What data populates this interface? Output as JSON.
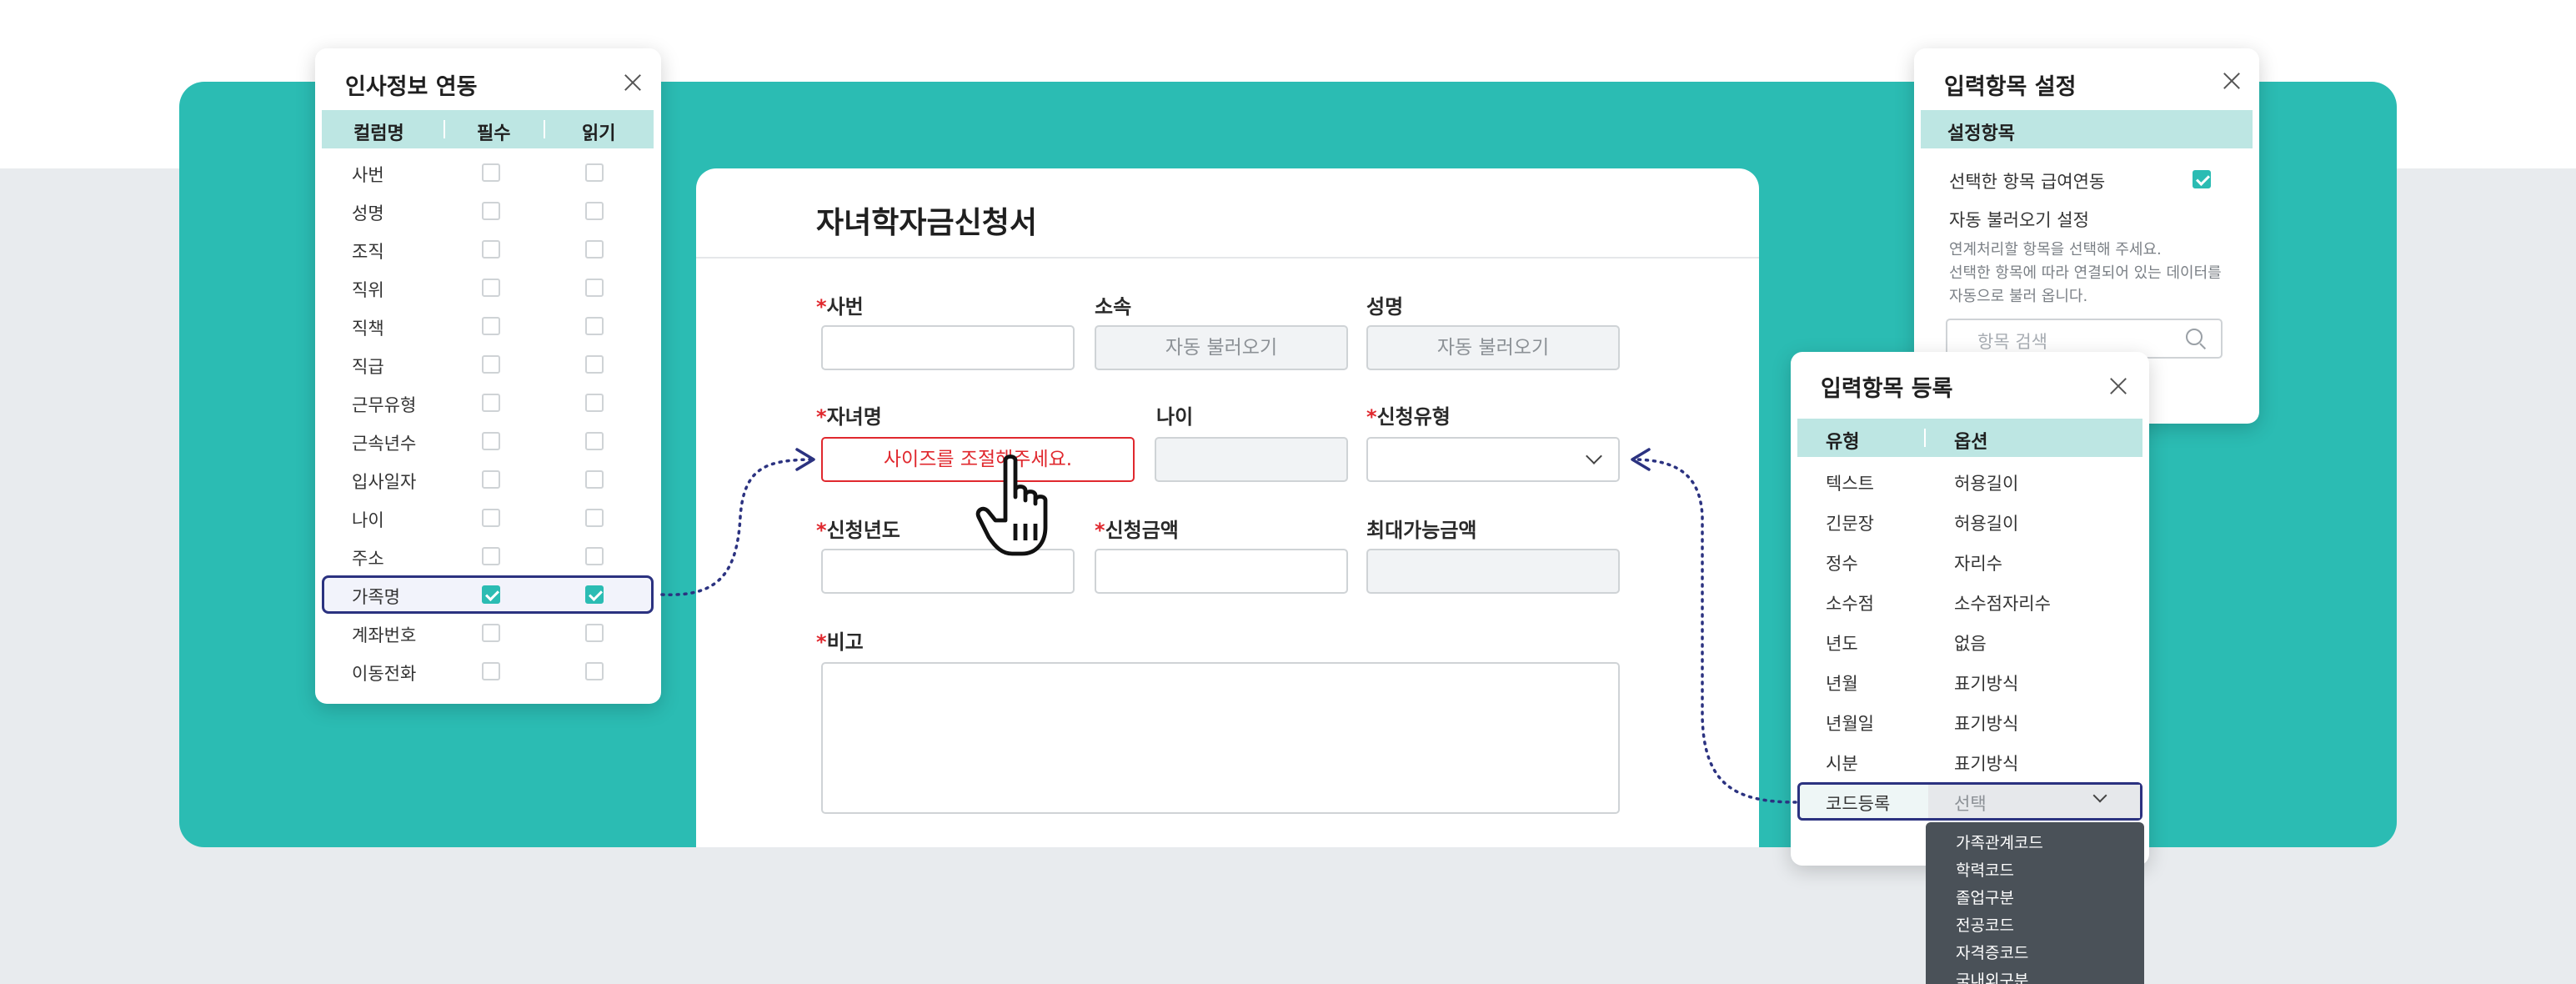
{
  "hr_panel": {
    "title": "인사정보 연동",
    "columns": [
      "컬럼명",
      "필수",
      "읽기"
    ],
    "rows": [
      {
        "label": "사번",
        "required": false,
        "read": false
      },
      {
        "label": "성명",
        "required": false,
        "read": false
      },
      {
        "label": "조직",
        "required": false,
        "read": false
      },
      {
        "label": "직위",
        "required": false,
        "read": false
      },
      {
        "label": "직책",
        "required": false,
        "read": false
      },
      {
        "label": "직급",
        "required": false,
        "read": false
      },
      {
        "label": "근무유형",
        "required": false,
        "read": false
      },
      {
        "label": "근속년수",
        "required": false,
        "read": false
      },
      {
        "label": "입사일자",
        "required": false,
        "read": false
      },
      {
        "label": "나이",
        "required": false,
        "read": false
      },
      {
        "label": "주소",
        "required": false,
        "read": false
      },
      {
        "label": "가족명",
        "required": true,
        "read": true
      },
      {
        "label": "계좌번호",
        "required": false,
        "read": false
      },
      {
        "label": "이동전화",
        "required": false,
        "read": false
      }
    ]
  },
  "form": {
    "title": "자녀학자금신청서",
    "required_mark": "*",
    "fields": {
      "emp_no": {
        "label": "사번",
        "value": ""
      },
      "dept": {
        "label": "소속",
        "value": "자동 불러오기"
      },
      "name": {
        "label": "성명",
        "value": "자동 불러오기"
      },
      "child_name": {
        "label": "자녀명",
        "value": "사이즈를 조절해주세요."
      },
      "age": {
        "label": "나이",
        "value": ""
      },
      "apply_type": {
        "label": "신청유형",
        "value": ""
      },
      "apply_year": {
        "label": "신청년도",
        "value": ""
      },
      "apply_amount": {
        "label": "신청금액",
        "value": ""
      },
      "max_amount": {
        "label": "최대가능금액",
        "value": ""
      },
      "remarks": {
        "label": "비고",
        "value": ""
      }
    }
  },
  "settings_panel": {
    "title": "입력항목 설정",
    "header": "설정항목",
    "payroll_link_label": "선택한 항목 급여연동",
    "payroll_link_checked": true,
    "autoload_label": "자동 불러오기 설정",
    "help_line1": "연계처리할 항목을 선택해 주세요.",
    "help_line2": "선택한 항목에 따라 연결되어 있는 데이터를",
    "help_line3": "자동으로 불러 옵니다.",
    "search_placeholder": "항목 검색"
  },
  "reg_panel": {
    "title": "입력항목 등록",
    "columns": [
      "유형",
      "옵션"
    ],
    "rows": [
      {
        "type": "텍스트",
        "option": "허용길이"
      },
      {
        "type": "긴문장",
        "option": "허용길이"
      },
      {
        "type": "정수",
        "option": "자리수"
      },
      {
        "type": "소수점",
        "option": "소수점자리수"
      },
      {
        "type": "년도",
        "option": "없음"
      },
      {
        "type": "년월",
        "option": "표기방식"
      },
      {
        "type": "년월일",
        "option": "표기방식"
      },
      {
        "type": "시분",
        "option": "표기방식"
      },
      {
        "type": "코드등록",
        "option": "선택"
      }
    ],
    "dropdown": [
      "가족관계코드",
      "학력코드",
      "졸업구분",
      "전공코드",
      "자격증코드",
      "국내외구분"
    ]
  },
  "colors": {
    "accent": "#2bbcb3",
    "header_bg": "#bde6e3",
    "selection_border": "#2b3280",
    "required": "#e0282e",
    "dropdown_bg": "#4a5158"
  },
  "icons": {
    "close": "close-icon",
    "search": "search-icon",
    "chevron": "chevron-down-icon",
    "check": "check-icon",
    "cursor": "hand-cursor-icon"
  }
}
